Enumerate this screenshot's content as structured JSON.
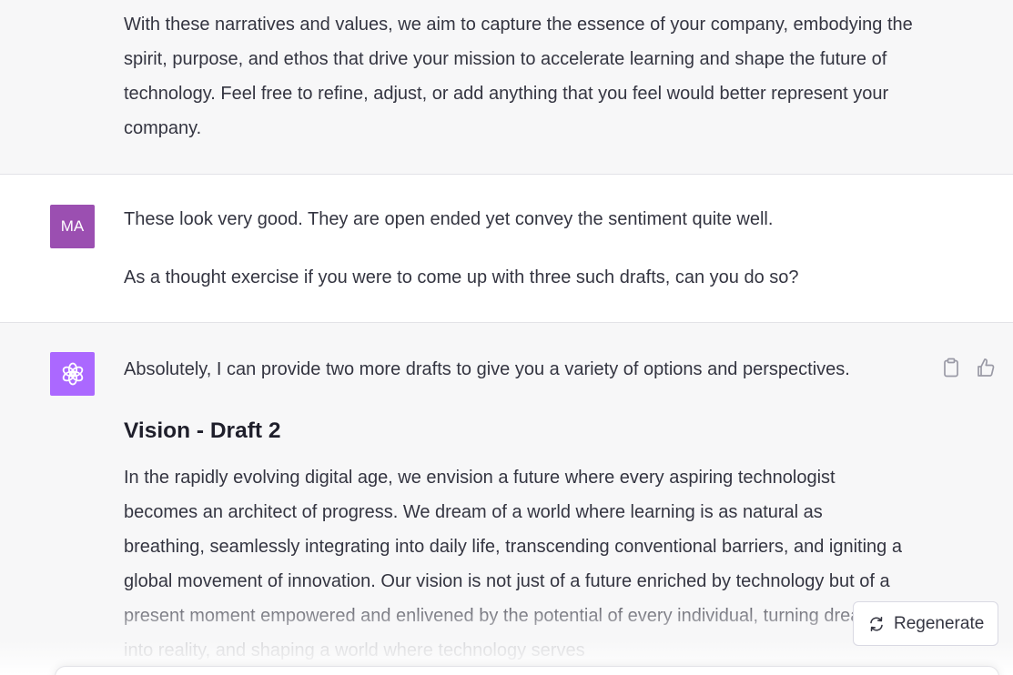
{
  "messages": {
    "prev_assistant": {
      "paragraph": "With these narratives and values, we aim to capture the essence of your company, embodying the spirit, purpose, and ethos that drive your mission to accelerate learning and shape the future of technology. Feel free to refine, adjust, or add anything that you feel would better represent your company."
    },
    "user": {
      "avatar_initials": "MA",
      "paragraph_1": "These look very good. They are open ended yet convey the sentiment quite well.",
      "paragraph_2": "As a thought exercise if you were to come up with three such drafts, can you do so?"
    },
    "assistant": {
      "intro": "Absolutely, I can provide two more drafts to give you a variety of options and perspectives.",
      "heading": "Vision - Draft 2",
      "paragraph": "In the rapidly evolving digital age, we envision a future where every aspiring technologist becomes an architect of progress. We dream of a world where learning is as natural as breathing, seamlessly integrating into daily life, transcending conventional barriers, and igniting a global movement of innovation. Our vision is not just of a future enriched by technology but of a present moment empowered and enlivened by the potential of every individual, turning dreams into reality, and shaping a world where technology serves"
    }
  },
  "actions": {
    "copy_icon": "clipboard-icon",
    "like_icon": "thumbs-up-icon"
  },
  "regenerate": {
    "label": "Regenerate",
    "icon": "refresh-icon"
  },
  "colors": {
    "assistant_bg": "#f7f7f8",
    "user_avatar": "#9b4fb1",
    "bot_avatar": "#ab68ff",
    "text": "#343541"
  }
}
